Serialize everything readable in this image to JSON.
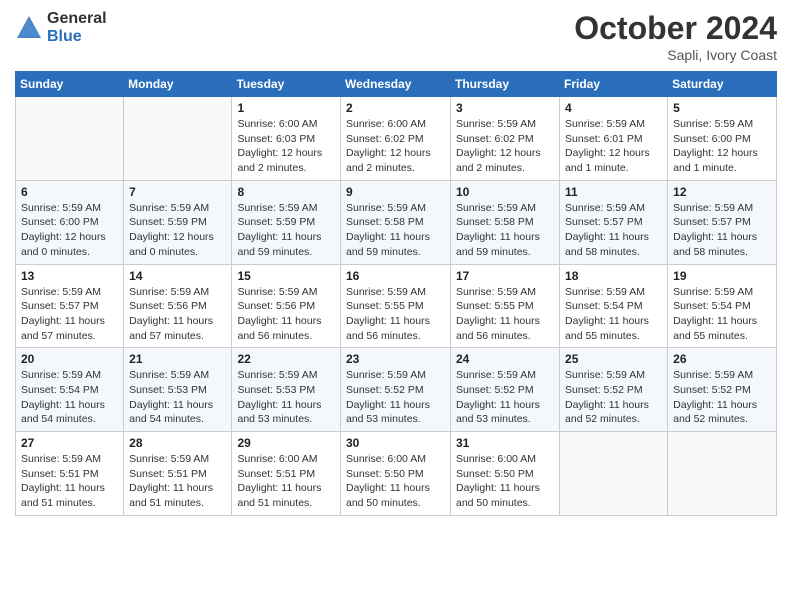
{
  "header": {
    "logo_general": "General",
    "logo_blue": "Blue",
    "month_title": "October 2024",
    "location": "Sapli, Ivory Coast"
  },
  "days_of_week": [
    "Sunday",
    "Monday",
    "Tuesday",
    "Wednesday",
    "Thursday",
    "Friday",
    "Saturday"
  ],
  "weeks": [
    [
      {
        "num": "",
        "info": ""
      },
      {
        "num": "",
        "info": ""
      },
      {
        "num": "1",
        "info": "Sunrise: 6:00 AM\nSunset: 6:03 PM\nDaylight: 12 hours and 2 minutes."
      },
      {
        "num": "2",
        "info": "Sunrise: 6:00 AM\nSunset: 6:02 PM\nDaylight: 12 hours and 2 minutes."
      },
      {
        "num": "3",
        "info": "Sunrise: 5:59 AM\nSunset: 6:02 PM\nDaylight: 12 hours and 2 minutes."
      },
      {
        "num": "4",
        "info": "Sunrise: 5:59 AM\nSunset: 6:01 PM\nDaylight: 12 hours and 1 minute."
      },
      {
        "num": "5",
        "info": "Sunrise: 5:59 AM\nSunset: 6:00 PM\nDaylight: 12 hours and 1 minute."
      }
    ],
    [
      {
        "num": "6",
        "info": "Sunrise: 5:59 AM\nSunset: 6:00 PM\nDaylight: 12 hours and 0 minutes."
      },
      {
        "num": "7",
        "info": "Sunrise: 5:59 AM\nSunset: 5:59 PM\nDaylight: 12 hours and 0 minutes."
      },
      {
        "num": "8",
        "info": "Sunrise: 5:59 AM\nSunset: 5:59 PM\nDaylight: 11 hours and 59 minutes."
      },
      {
        "num": "9",
        "info": "Sunrise: 5:59 AM\nSunset: 5:58 PM\nDaylight: 11 hours and 59 minutes."
      },
      {
        "num": "10",
        "info": "Sunrise: 5:59 AM\nSunset: 5:58 PM\nDaylight: 11 hours and 59 minutes."
      },
      {
        "num": "11",
        "info": "Sunrise: 5:59 AM\nSunset: 5:57 PM\nDaylight: 11 hours and 58 minutes."
      },
      {
        "num": "12",
        "info": "Sunrise: 5:59 AM\nSunset: 5:57 PM\nDaylight: 11 hours and 58 minutes."
      }
    ],
    [
      {
        "num": "13",
        "info": "Sunrise: 5:59 AM\nSunset: 5:57 PM\nDaylight: 11 hours and 57 minutes."
      },
      {
        "num": "14",
        "info": "Sunrise: 5:59 AM\nSunset: 5:56 PM\nDaylight: 11 hours and 57 minutes."
      },
      {
        "num": "15",
        "info": "Sunrise: 5:59 AM\nSunset: 5:56 PM\nDaylight: 11 hours and 56 minutes."
      },
      {
        "num": "16",
        "info": "Sunrise: 5:59 AM\nSunset: 5:55 PM\nDaylight: 11 hours and 56 minutes."
      },
      {
        "num": "17",
        "info": "Sunrise: 5:59 AM\nSunset: 5:55 PM\nDaylight: 11 hours and 56 minutes."
      },
      {
        "num": "18",
        "info": "Sunrise: 5:59 AM\nSunset: 5:54 PM\nDaylight: 11 hours and 55 minutes."
      },
      {
        "num": "19",
        "info": "Sunrise: 5:59 AM\nSunset: 5:54 PM\nDaylight: 11 hours and 55 minutes."
      }
    ],
    [
      {
        "num": "20",
        "info": "Sunrise: 5:59 AM\nSunset: 5:54 PM\nDaylight: 11 hours and 54 minutes."
      },
      {
        "num": "21",
        "info": "Sunrise: 5:59 AM\nSunset: 5:53 PM\nDaylight: 11 hours and 54 minutes."
      },
      {
        "num": "22",
        "info": "Sunrise: 5:59 AM\nSunset: 5:53 PM\nDaylight: 11 hours and 53 minutes."
      },
      {
        "num": "23",
        "info": "Sunrise: 5:59 AM\nSunset: 5:52 PM\nDaylight: 11 hours and 53 minutes."
      },
      {
        "num": "24",
        "info": "Sunrise: 5:59 AM\nSunset: 5:52 PM\nDaylight: 11 hours and 53 minutes."
      },
      {
        "num": "25",
        "info": "Sunrise: 5:59 AM\nSunset: 5:52 PM\nDaylight: 11 hours and 52 minutes."
      },
      {
        "num": "26",
        "info": "Sunrise: 5:59 AM\nSunset: 5:52 PM\nDaylight: 11 hours and 52 minutes."
      }
    ],
    [
      {
        "num": "27",
        "info": "Sunrise: 5:59 AM\nSunset: 5:51 PM\nDaylight: 11 hours and 51 minutes."
      },
      {
        "num": "28",
        "info": "Sunrise: 5:59 AM\nSunset: 5:51 PM\nDaylight: 11 hours and 51 minutes."
      },
      {
        "num": "29",
        "info": "Sunrise: 6:00 AM\nSunset: 5:51 PM\nDaylight: 11 hours and 51 minutes."
      },
      {
        "num": "30",
        "info": "Sunrise: 6:00 AM\nSunset: 5:50 PM\nDaylight: 11 hours and 50 minutes."
      },
      {
        "num": "31",
        "info": "Sunrise: 6:00 AM\nSunset: 5:50 PM\nDaylight: 11 hours and 50 minutes."
      },
      {
        "num": "",
        "info": ""
      },
      {
        "num": "",
        "info": ""
      }
    ]
  ]
}
